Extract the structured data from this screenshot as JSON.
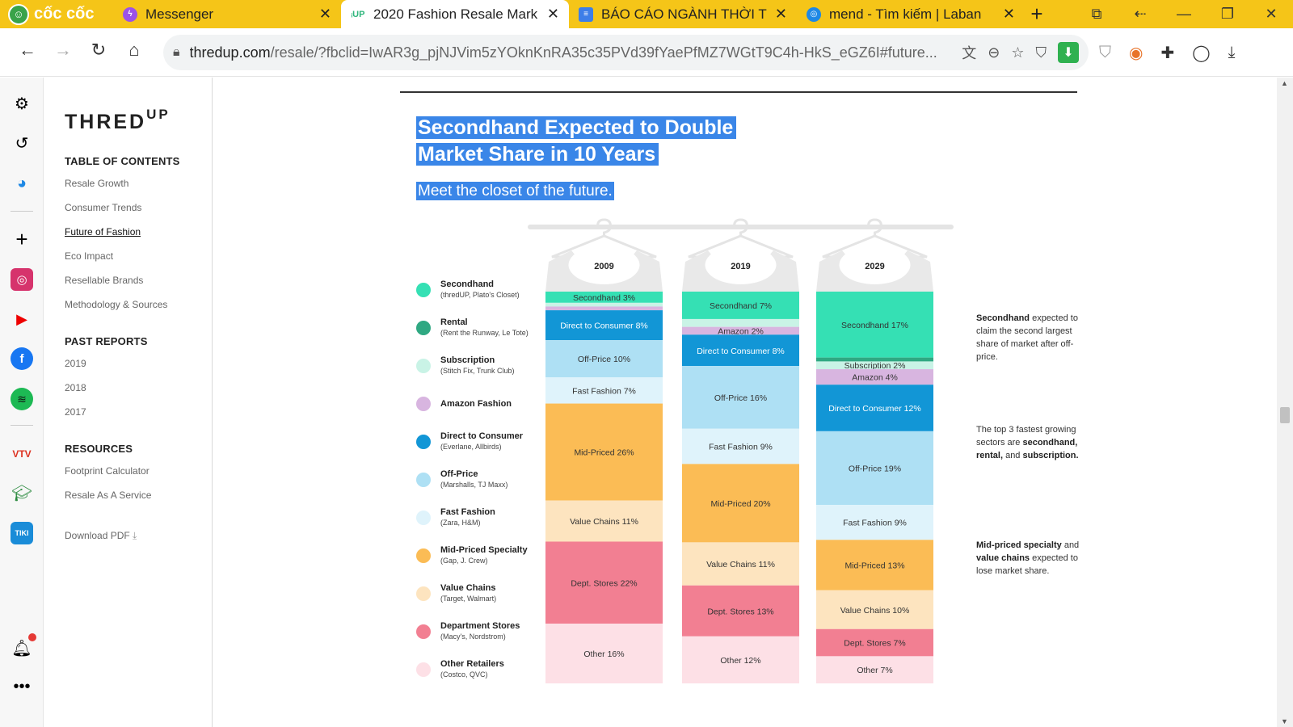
{
  "browser": {
    "brand": "cốc cốc",
    "tabs": [
      {
        "title": "Messenger",
        "favicon_color": "#9b52e8",
        "active": false
      },
      {
        "title": "2020 Fashion Resale Mark",
        "favicon_color": "#2fb67c",
        "active": true
      },
      {
        "title": "BÁO CÁO NGÀNH THỜI T",
        "favicon_color": "#3d7ee8",
        "active": false
      },
      {
        "title": "mend - Tìm kiếm | Laban",
        "favicon_color": "#1e88e5",
        "active": false
      }
    ],
    "url_host": "thredup.com",
    "url_path": "/resale/?fbclid=IwAR3g_pjNJVim5zYOknKnRA35c35PVd39fYaePfMZ7WGtT9C4h-HkS_eGZ6I#future..."
  },
  "toc": {
    "logo": "THRED",
    "logo_sup": "UP",
    "heading_contents": "TABLE OF CONTENTS",
    "contents": [
      "Resale Growth",
      "Consumer Trends",
      "Future of Fashion",
      "Eco Impact",
      "Resellable Brands",
      "Methodology & Sources"
    ],
    "heading_past": "PAST REPORTS",
    "past": [
      "2019",
      "2018",
      "2017"
    ],
    "heading_resources": "RESOURCES",
    "resources": [
      "Footprint Calculator",
      "Resale As A Service"
    ],
    "download": "Download PDF"
  },
  "article": {
    "title_line1": "Secondhand Expected to Double",
    "title_line2": "Market Share in 10 Years",
    "subtitle": "Meet the closet of the future."
  },
  "legend": [
    {
      "name": "Secondhand",
      "sub": "(thredUP, Plato's Closet)",
      "color": "#35e0b4"
    },
    {
      "name": "Rental",
      "sub": "(Rent the Runway, Le Tote)",
      "color": "#2fa882"
    },
    {
      "name": "Subscription",
      "sub": "(Stitch Fix, Trunk Club)",
      "color": "#c9f3e6"
    },
    {
      "name": "Amazon Fashion",
      "sub": "",
      "color": "#d8b5e0"
    },
    {
      "name": "Direct to Consumer",
      "sub": "(Everlane, Allbirds)",
      "color": "#1296d6"
    },
    {
      "name": "Off-Price",
      "sub": "(Marshalls, TJ Maxx)",
      "color": "#aee0f4"
    },
    {
      "name": "Fast Fashion",
      "sub": "(Zara, H&M)",
      "color": "#dff3fb"
    },
    {
      "name": "Mid-Priced Specialty",
      "sub": "(Gap, J. Crew)",
      "color": "#fbbc55"
    },
    {
      "name": "Value Chains",
      "sub": "(Target, Walmart)",
      "color": "#fde4bf"
    },
    {
      "name": "Department Stores",
      "sub": "(Macy's, Nordstrom)",
      "color": "#f27f92"
    },
    {
      "name": "Other Retailers",
      "sub": "(Costco, QVC)",
      "color": "#fde0e6"
    }
  ],
  "chart_data": {
    "type": "bar",
    "stacked": true,
    "categories": [
      "2009",
      "2019",
      "2029"
    ],
    "ylim": [
      0,
      100
    ],
    "series": [
      {
        "name": "Secondhand",
        "values": [
          3,
          7,
          17
        ],
        "labels": [
          "Secondhand 3%",
          "Secondhand 7%",
          "Secondhand 17%"
        ],
        "color": "#35e0b4"
      },
      {
        "name": "Rental",
        "values": [
          0,
          0,
          1
        ],
        "labels": [
          "",
          "",
          ""
        ],
        "color": "#2fa882"
      },
      {
        "name": "Subscription",
        "values": [
          1,
          2,
          2
        ],
        "labels": [
          "",
          "",
          "Subscription 2%"
        ],
        "color": "#c9f3e6"
      },
      {
        "name": "Amazon Fashion",
        "values": [
          1,
          2,
          4
        ],
        "labels": [
          "",
          "Amazon 2%",
          "Amazon 4%"
        ],
        "color": "#d8b5e0"
      },
      {
        "name": "Direct to Consumer",
        "values": [
          8,
          8,
          12
        ],
        "labels": [
          "Direct to Consumer 8%",
          "Direct to Consumer 8%",
          "Direct to Consumer 12%"
        ],
        "color": "#1296d6"
      },
      {
        "name": "Off-Price",
        "values": [
          10,
          16,
          19
        ],
        "labels": [
          "Off-Price 10%",
          "Off-Price 16%",
          "Off-Price 19%"
        ],
        "color": "#aee0f4"
      },
      {
        "name": "Fast Fashion",
        "values": [
          7,
          9,
          9
        ],
        "labels": [
          "Fast Fashion 7%",
          "Fast Fashion 9%",
          "Fast Fashion 9%"
        ],
        "color": "#dff3fb"
      },
      {
        "name": "Mid-Priced Specialty",
        "values": [
          26,
          20,
          13
        ],
        "labels": [
          "Mid-Priced 26%",
          "Mid-Priced 20%",
          "Mid-Priced 13%"
        ],
        "color": "#fbbc55"
      },
      {
        "name": "Value Chains",
        "values": [
          11,
          11,
          10
        ],
        "labels": [
          "Value Chains 11%",
          "Value Chains 11%",
          "Value Chains 10%"
        ],
        "color": "#fde4bf"
      },
      {
        "name": "Department Stores",
        "values": [
          22,
          13,
          7
        ],
        "labels": [
          "Dept. Stores 22%",
          "Dept. Stores 13%",
          "Dept. Stores 7%"
        ],
        "color": "#f27f92"
      },
      {
        "name": "Other Retailers",
        "values": [
          16,
          12,
          7
        ],
        "labels": [
          "Other 16%",
          "Other 12%",
          "Other 7%"
        ],
        "color": "#fde0e6"
      }
    ]
  },
  "annotations": [
    {
      "bold": "Secondhand",
      "text": " expected to claim the second largest share of market after off-price."
    },
    {
      "pre": "The top 3 fastest growing sectors are ",
      "bold": "secondhand, rental,",
      "mid": " and ",
      "bold2": "subscription."
    },
    {
      "bold": "Mid-priced specialty",
      "mid": " and ",
      "bold2": "value chains",
      "text": " expected to lose market share."
    }
  ]
}
